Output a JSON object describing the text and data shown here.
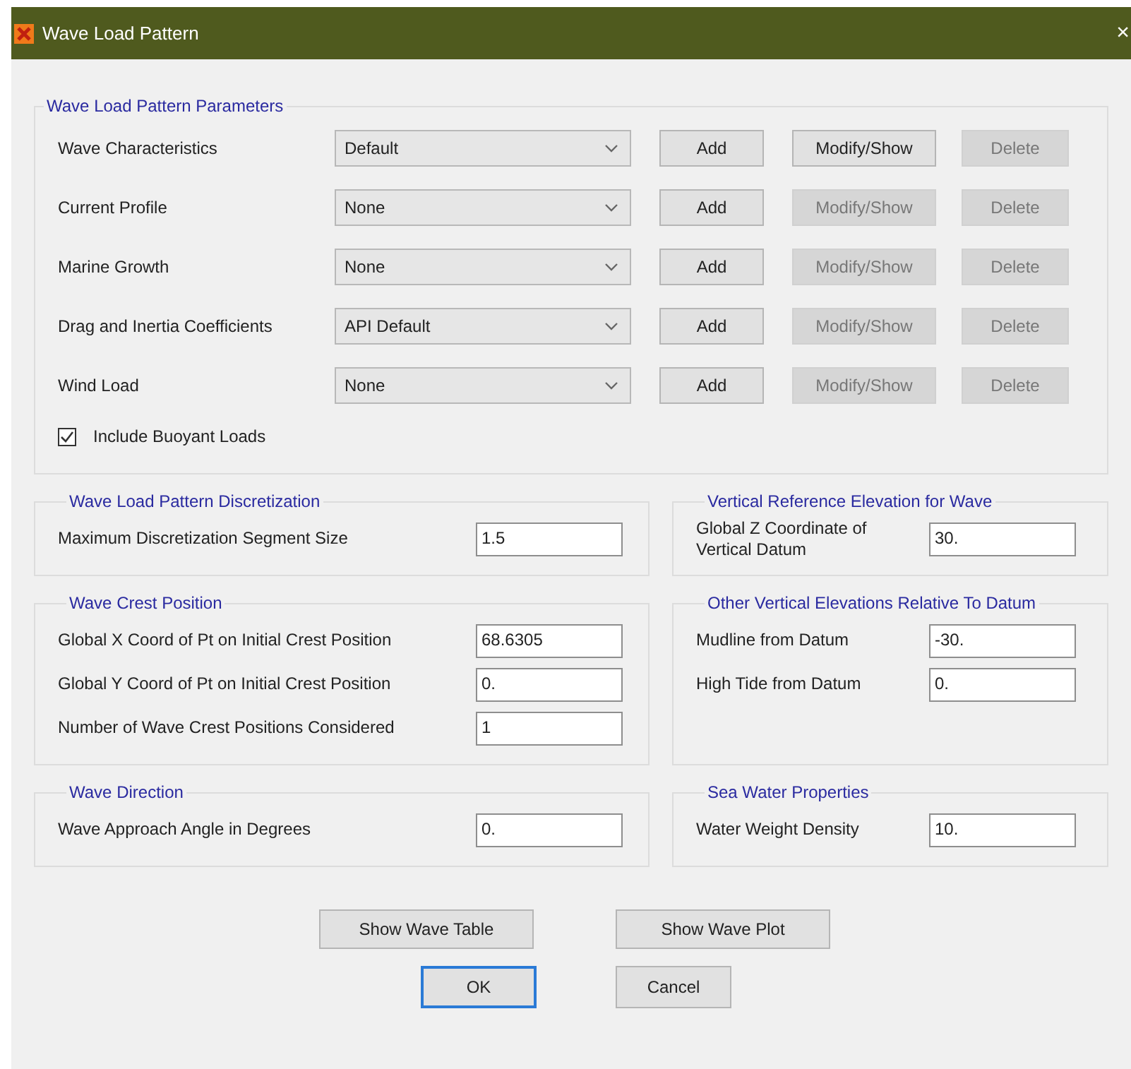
{
  "window": {
    "title": "Wave Load Pattern",
    "close": "×"
  },
  "parameters": {
    "title": "Wave Load Pattern Parameters",
    "rows": [
      {
        "label": "Wave Characteristics",
        "value": "Default",
        "buttons": [
          {
            "label": "Add",
            "disabled": false
          },
          {
            "label": "Modify/Show",
            "disabled": false
          },
          {
            "label": "Delete",
            "disabled": true
          }
        ]
      },
      {
        "label": "Current Profile",
        "value": "None",
        "buttons": [
          {
            "label": "Add",
            "disabled": false
          },
          {
            "label": "Modify/Show",
            "disabled": true
          },
          {
            "label": "Delete",
            "disabled": true
          }
        ]
      },
      {
        "label": "Marine Growth",
        "value": "None",
        "buttons": [
          {
            "label": "Add",
            "disabled": false
          },
          {
            "label": "Modify/Show",
            "disabled": true
          },
          {
            "label": "Delete",
            "disabled": true
          }
        ]
      },
      {
        "label": "Drag and Inertia Coefficients",
        "value": "API Default",
        "buttons": [
          {
            "label": "Add",
            "disabled": false
          },
          {
            "label": "Modify/Show",
            "disabled": true
          },
          {
            "label": "Delete",
            "disabled": true
          }
        ]
      },
      {
        "label": "Wind Load",
        "value": "None",
        "buttons": [
          {
            "label": "Add",
            "disabled": false
          },
          {
            "label": "Modify/Show",
            "disabled": true
          },
          {
            "label": "Delete",
            "disabled": true
          }
        ]
      }
    ],
    "buoyant": {
      "label": "Include Buoyant Loads",
      "checked": true
    }
  },
  "group_rows": [
    [
      {
        "title": "Wave Load Pattern Discretization",
        "fields": [
          {
            "label": "Maximum Discretization Segment Size",
            "value": "1.5"
          }
        ]
      },
      {
        "title": "Vertical Reference Elevation for Wave",
        "fields": [
          {
            "label": "Global Z Coordinate of Vertical Datum",
            "value": "30."
          }
        ]
      }
    ],
    [
      {
        "title": "Wave Crest Position",
        "fields": [
          {
            "label": "Global X Coord of Pt on Initial Crest Position",
            "value": "68.6305"
          },
          {
            "label": "Global Y Coord of Pt on Initial Crest Position",
            "value": "0."
          },
          {
            "label": "Number of Wave Crest Positions Considered",
            "value": "1"
          }
        ]
      },
      {
        "title": "Other Vertical Elevations Relative To Datum",
        "fields": [
          {
            "label": "Mudline from Datum",
            "value": "-30."
          },
          {
            "label": "High Tide from Datum",
            "value": "0."
          }
        ]
      }
    ],
    [
      {
        "title": "Wave Direction",
        "fields": [
          {
            "label": "Wave Approach Angle in Degrees",
            "value": "0."
          }
        ]
      },
      {
        "title": "Sea Water Properties",
        "fields": [
          {
            "label": "Water Weight Density",
            "value": "10."
          }
        ]
      }
    ]
  ],
  "show_buttons": [
    {
      "label": "Show Wave Table"
    },
    {
      "label": "Show Wave Plot"
    }
  ],
  "dialog_buttons": [
    {
      "label": "OK",
      "default": true
    },
    {
      "label": "Cancel",
      "default": false
    }
  ]
}
